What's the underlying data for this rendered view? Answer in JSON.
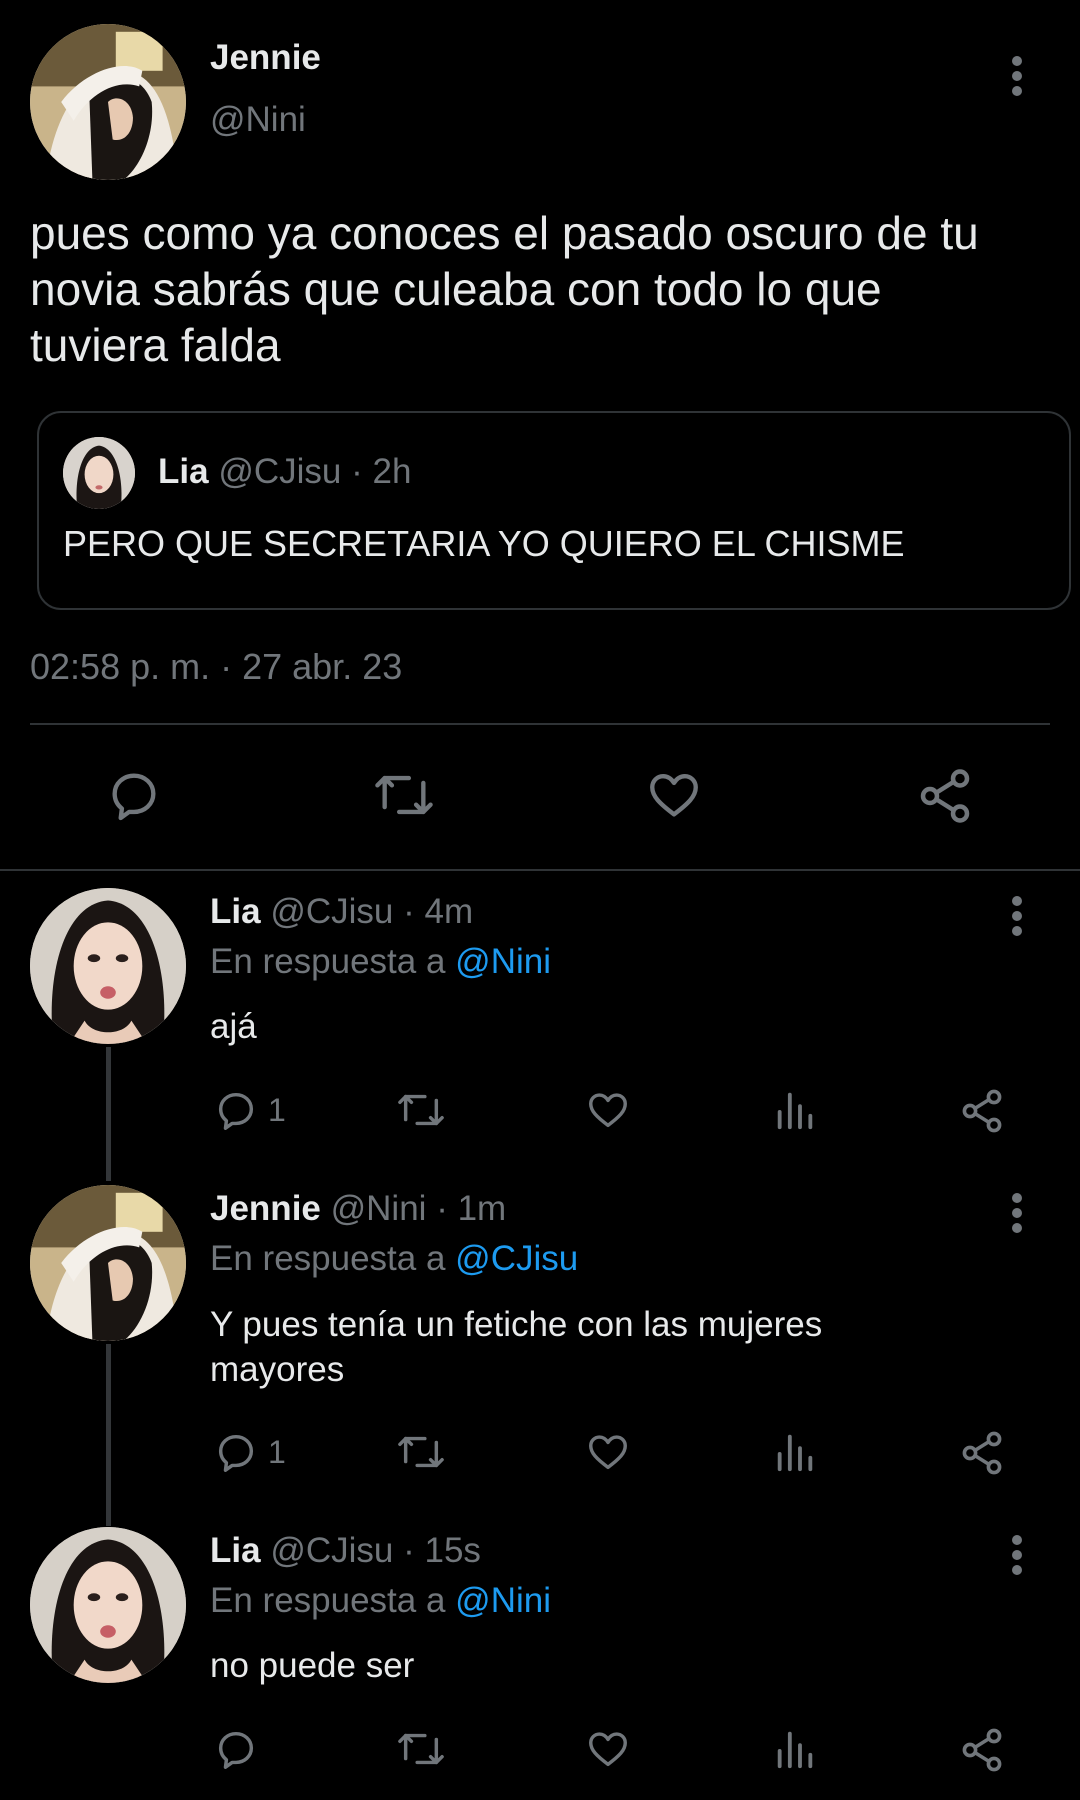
{
  "main_tweet": {
    "display_name": "Jennie",
    "handle": "@Nini",
    "text_lines": [
      "pues como ya conoces el pasado oscuro de tu",
      "novia sabrás que culeaba con todo lo que",
      "tuviera falda"
    ],
    "quote": {
      "display_name": "Lia",
      "handle": "@CJisu",
      "time": "· 2h",
      "text": "PERO QUE SECRETARIA YO QUIERO EL CHISME"
    },
    "timestamp": "02:58 p. m. · 27 abr. 23"
  },
  "replies": [
    {
      "display_name": "Lia",
      "handle": "@CJisu",
      "time": "· 4m",
      "reply_prefix": "En respuesta a",
      "reply_to": "@Nini",
      "text_lines": [
        "ajá"
      ],
      "reply_count": "1"
    },
    {
      "display_name": "Jennie",
      "handle": "@Nini",
      "time": "· 1m",
      "reply_prefix": "En respuesta a",
      "reply_to": "@CJisu",
      "text_lines": [
        "Y pues tenía un fetiche con las mujeres",
        "mayores"
      ],
      "reply_count": "1"
    },
    {
      "display_name": "Lia",
      "handle": "@CJisu",
      "time": "· 15s",
      "reply_prefix": "En respuesta a",
      "reply_to": "@Nini",
      "text_lines": [
        "no puede ser"
      ],
      "reply_count": ""
    }
  ],
  "icons": {
    "reply": "speech-bubble-icon",
    "retweet": "retweet-arrows-icon",
    "like": "heart-icon",
    "views": "bar-chart-icon",
    "share": "share-nodes-icon",
    "more": "vertical-dots-icon"
  },
  "colors": {
    "background": "#000000",
    "text": "#e7e9ea",
    "muted": "#71767b",
    "link": "#1d9bf0",
    "border": "#2f3336"
  }
}
